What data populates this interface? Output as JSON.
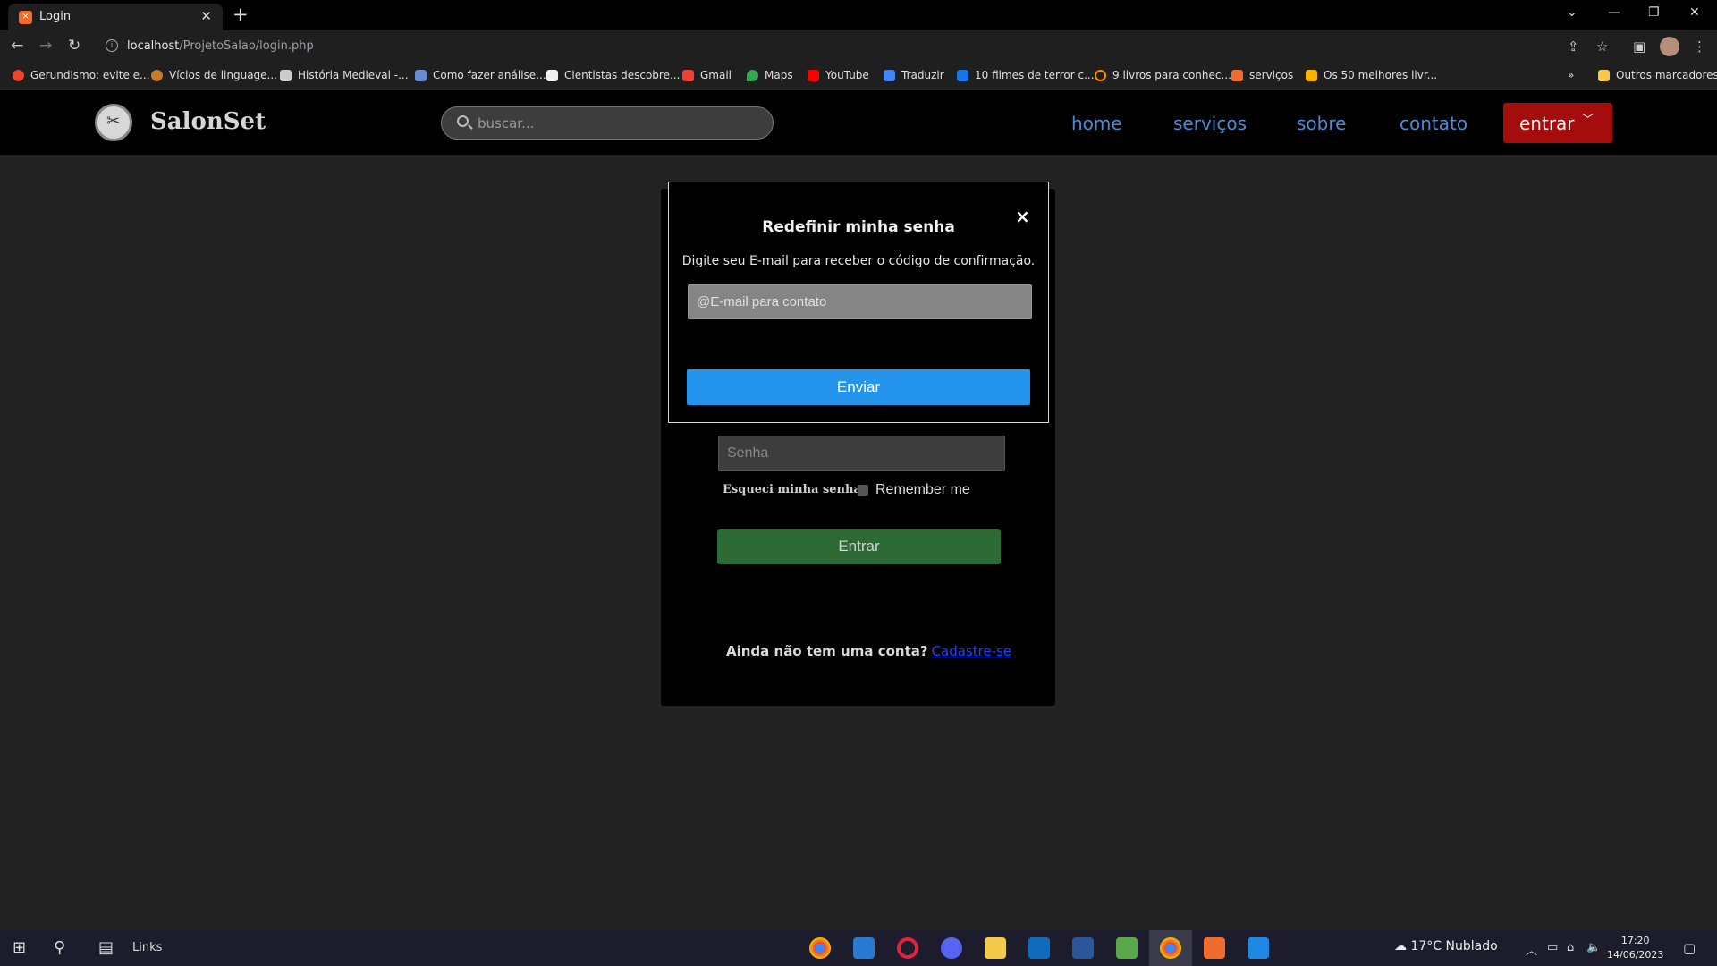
{
  "browser": {
    "tab_title": "Login",
    "url_host": "localhost",
    "url_path": "/ProjetoSalao/login.php",
    "bookmarks": [
      {
        "label": "Gerundismo: evite e...",
        "color": "#e9472c"
      },
      {
        "label": "Vícios de linguage...",
        "color": "#c77c2c"
      },
      {
        "label": "História Medieval -...",
        "color": "#cccccc"
      },
      {
        "label": "Como fazer análise...",
        "color": "#6a8ad2"
      },
      {
        "label": "Cientistas descobre...",
        "color": "#f0f0f0"
      },
      {
        "label": "Gmail",
        "color": "#ea4335"
      },
      {
        "label": "Maps",
        "color": "#34a853"
      },
      {
        "label": "YouTube",
        "color": "#ff0000"
      },
      {
        "label": "Traduzir",
        "color": "#4285f4"
      },
      {
        "label": "10 filmes de terror c...",
        "color": "#1a73e8"
      },
      {
        "label": "9 livros para conhec...",
        "color": "#ff8a00"
      },
      {
        "label": "serviços",
        "color": "#ef6c2f"
      },
      {
        "label": "Os 50 melhores livr...",
        "color": "#f5b400"
      }
    ],
    "other_bookmarks": "Outros marcadores"
  },
  "site": {
    "brand": "SalonSet",
    "search_placeholder": "buscar...",
    "nav": [
      "home",
      "serviços",
      "sobre",
      "contato"
    ],
    "login_menu": "entrar",
    "nav_color": "#4a8bd6",
    "login_menu_color": "#a50d0d"
  },
  "login": {
    "password_placeholder": "Senha",
    "forgot": "Esqueci minha senha",
    "remember": "Remember me",
    "submit": "Entrar",
    "no_account": "Ainda não tem uma conta?",
    "signup": "Cadastre-se"
  },
  "modal": {
    "title": "Redefinir minha senha",
    "close": "×",
    "subtitle": "Digite seu E-mail para receber o código de confirmação.",
    "email_placeholder": "@E-mail para contato",
    "send": "Enviar",
    "send_color": "#2594ec"
  },
  "taskbar": {
    "links": "Links",
    "weather": "17°C  Nublado",
    "time": "17:20",
    "date": "14/06/2023"
  }
}
